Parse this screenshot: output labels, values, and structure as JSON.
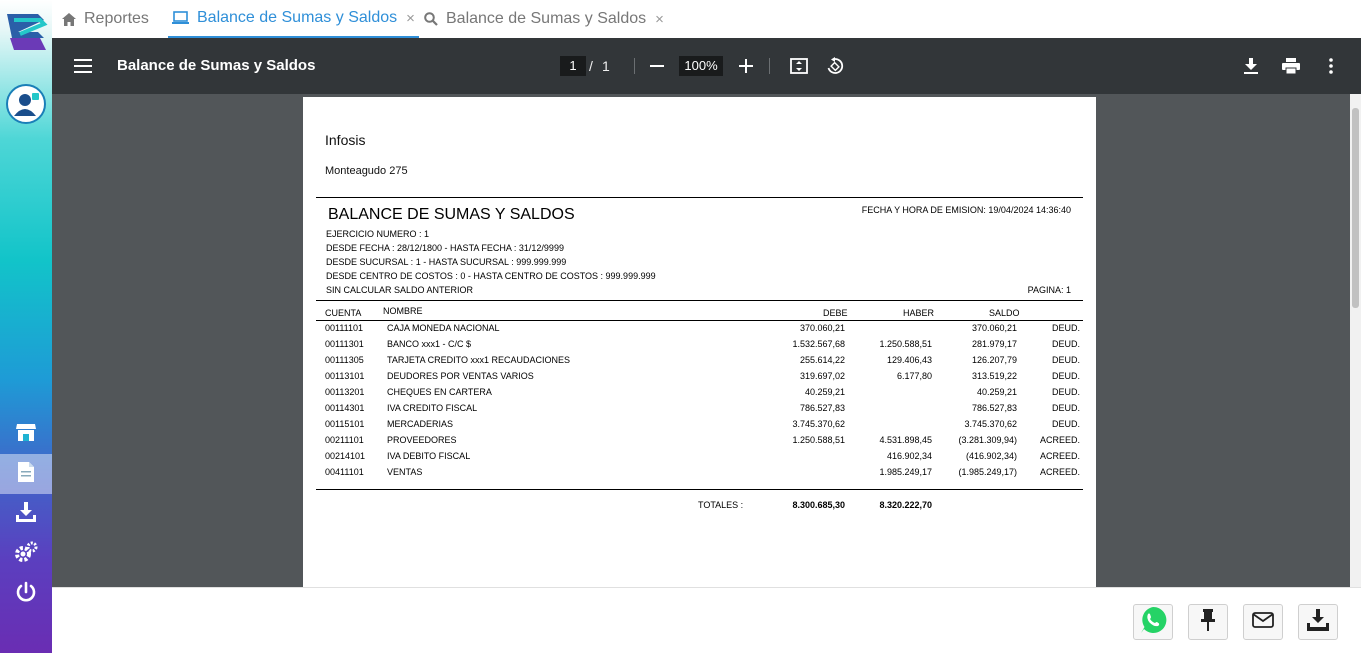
{
  "tabs": [
    {
      "label": "Reportes",
      "icon": "home-icon",
      "active": false,
      "closable": false
    },
    {
      "label": "Balance de Sumas y Saldos",
      "icon": "monitor-icon",
      "active": true,
      "closable": true
    },
    {
      "label": "Balance de Sumas y Saldos",
      "icon": "search-icon",
      "active": false,
      "closable": true
    }
  ],
  "tab_close_glyph": "×",
  "toolbar": {
    "title": "Balance de Sumas y Saldos",
    "page_current": "1",
    "page_separator": "/",
    "page_total": "1",
    "zoom": "100%"
  },
  "document": {
    "company": "Infosis",
    "address": "Monteagudo 275",
    "title": "BALANCE DE SUMAS Y SALDOS",
    "emision": "FECHA Y HORA DE EMISION: 19/04/2024 14:36:40",
    "params": [
      "EJERCICIO NUMERO : 1",
      "DESDE FECHA : 28/12/1800 - HASTA FECHA : 31/12/9999",
      "DESDE SUCURSAL : 1 - HASTA SUCURSAL : 999.999.999",
      "DESDE CENTRO DE COSTOS : 0 - HASTA CENTRO DE COSTOS : 999.999.999",
      "SIN CALCULAR SALDO ANTERIOR"
    ],
    "pagina": "PAGINA: 1",
    "headers": {
      "cuenta": "CUENTA",
      "nombre": "NOMBRE",
      "debe": "DEBE",
      "haber": "HABER",
      "saldo": "SALDO"
    },
    "rows": [
      {
        "cuenta": "00111101",
        "nombre": "CAJA MONEDA NACIONAL",
        "debe": "370.060,21",
        "haber": "",
        "saldo": "370.060,21",
        "tipo": "DEUD."
      },
      {
        "cuenta": "00111301",
        "nombre": "BANCO xxx1 - C/C $",
        "debe": "1.532.567,68",
        "haber": "1.250.588,51",
        "saldo": "281.979,17",
        "tipo": "DEUD."
      },
      {
        "cuenta": "00111305",
        "nombre": "TARJETA CREDITO xxx1 RECAUDACIONES",
        "debe": "255.614,22",
        "haber": "129.406,43",
        "saldo": "126.207,79",
        "tipo": "DEUD."
      },
      {
        "cuenta": "00113101",
        "nombre": "DEUDORES POR VENTAS VARIOS",
        "debe": "319.697,02",
        "haber": "6.177,80",
        "saldo": "313.519,22",
        "tipo": "DEUD."
      },
      {
        "cuenta": "00113201",
        "nombre": "CHEQUES EN CARTERA",
        "debe": "40.259,21",
        "haber": "",
        "saldo": "40.259,21",
        "tipo": "DEUD."
      },
      {
        "cuenta": "00114301",
        "nombre": "IVA CREDITO FISCAL",
        "debe": "786.527,83",
        "haber": "",
        "saldo": "786.527,83",
        "tipo": "DEUD."
      },
      {
        "cuenta": "00115101",
        "nombre": "MERCADERIAS",
        "debe": "3.745.370,62",
        "haber": "",
        "saldo": "3.745.370,62",
        "tipo": "DEUD."
      },
      {
        "cuenta": "00211101",
        "nombre": "PROVEEDORES",
        "debe": "1.250.588,51",
        "haber": "4.531.898,45",
        "saldo": "(3.281.309,94)",
        "tipo": "ACREED."
      },
      {
        "cuenta": "00214101",
        "nombre": "IVA DEBITO FISCAL",
        "debe": "",
        "haber": "416.902,34",
        "saldo": "(416.902,34)",
        "tipo": "ACREED."
      },
      {
        "cuenta": "00411101",
        "nombre": "VENTAS",
        "debe": "",
        "haber": "1.985.249,17",
        "saldo": "(1.985.249,17)",
        "tipo": "ACREED."
      }
    ],
    "totals": {
      "label": "TOTALES :",
      "debe": "8.300.685,30",
      "haber": "8.320.222,70"
    }
  },
  "sidebar": {
    "items": [
      {
        "icon": "store-icon",
        "active": false
      },
      {
        "icon": "document-icon",
        "active": true
      },
      {
        "icon": "download-tray-icon",
        "active": false
      },
      {
        "icon": "settings-gears-icon",
        "active": false
      },
      {
        "icon": "power-icon",
        "active": false
      }
    ]
  },
  "actions": [
    {
      "icon": "whatsapp-icon"
    },
    {
      "icon": "pin-icon"
    },
    {
      "icon": "mail-icon"
    },
    {
      "icon": "download-icon"
    }
  ],
  "colors": {
    "accent": "#2f8fd8",
    "toolbar_bg": "#323639",
    "viewer_bg": "#525659",
    "whatsapp": "#25d366"
  }
}
